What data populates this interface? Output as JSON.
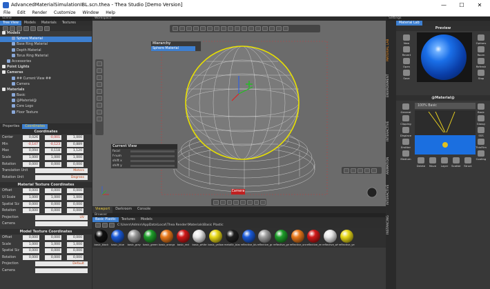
{
  "window": {
    "title": "AdvancedMaterialSimulationIBL.scn.thea - Thea Studio [Demo Version]",
    "minimize": "—",
    "maximize": "☐",
    "close": "✕"
  },
  "menu": [
    "File",
    "Edit",
    "Render",
    "Customize",
    "Window",
    "Help"
  ],
  "scene": {
    "header": "Scene",
    "tabs": [
      "Tree View",
      "Models",
      "Materials",
      "Textures"
    ],
    "tree": [
      {
        "label": "Models",
        "level": 0,
        "bold": true
      },
      {
        "label": "Sphere Material",
        "level": 2,
        "selected": true
      },
      {
        "label": "Base Ring Material",
        "level": 2
      },
      {
        "label": "Depth Material",
        "level": 2
      },
      {
        "label": "Torus Ring Material",
        "level": 2
      },
      {
        "label": "Accessories",
        "level": 1
      },
      {
        "label": "Point Lights",
        "level": 0,
        "bold": true
      },
      {
        "label": "Cameras",
        "level": 0,
        "bold": true
      },
      {
        "label": "## Current View ##",
        "level": 2
      },
      {
        "label": "Camera",
        "level": 2
      },
      {
        "label": "Materials",
        "level": 0,
        "bold": true
      },
      {
        "label": "Basic",
        "level": 2
      },
      {
        "label": "@Material@",
        "level": 2
      },
      {
        "label": "Core Logo",
        "level": 2
      },
      {
        "label": "Floor Texture",
        "level": 2
      }
    ]
  },
  "props": {
    "tabs": [
      "Properties",
      "Coordinates"
    ],
    "coord_title": "Coordinates",
    "coord_rows": [
      {
        "label": "Center",
        "v": [
          "0,026",
          "-0,001",
          "1,000"
        ],
        "red": [
          false,
          true,
          false
        ]
      },
      {
        "label": "Min",
        "v": [
          "-0,147",
          "-0,123",
          "0,889"
        ],
        "red": [
          true,
          true,
          false
        ]
      },
      {
        "label": "Max",
        "v": [
          "0,094",
          "0,118",
          "1,120"
        ],
        "red": [
          false,
          false,
          false
        ]
      },
      {
        "label": "Scale",
        "v": [
          "1,000",
          "1,000",
          "1,000"
        ],
        "red": [
          false,
          false,
          false
        ]
      },
      {
        "label": "Rotation",
        "v": [
          "0,000",
          "0,000",
          "0,000"
        ],
        "red": [
          false,
          false,
          false
        ]
      }
    ],
    "translation_unit": {
      "label": "Translation Unit",
      "value": "Meters"
    },
    "rotation_unit": {
      "label": "Rotation Unit",
      "value": "Degrees"
    },
    "mtc_title": "Material Texture Coordinates",
    "mtc_rows": [
      {
        "label": "Offset",
        "v": [
          "0,000",
          "0,000",
          "0,000"
        ]
      },
      {
        "label": "UI Scale",
        "v": [
          "1,000",
          "1,000",
          "1,000"
        ]
      },
      {
        "label": "Spatial Siz",
        "v": [
          "0,000",
          "0,000",
          "0,000"
        ]
      },
      {
        "label": "Rotation",
        "v": [
          "0,000",
          "0,000",
          "0,000"
        ]
      }
    ],
    "mtc_projection": {
      "label": "Projection",
      "value": "UV"
    },
    "mtc_camera": {
      "label": "Camera",
      "value": ""
    },
    "model_title": "Model Texture Coordinates",
    "model_rows": [
      {
        "label": "Offset",
        "v": [
          "0,000",
          "0,000",
          "0,000"
        ]
      },
      {
        "label": "Scale",
        "v": [
          "1,000",
          "1,000",
          "1,000"
        ]
      },
      {
        "label": "Spatial Siz",
        "v": [
          "0,000",
          "0,000",
          "0,000"
        ]
      },
      {
        "label": "Rotation",
        "v": [
          "0,000",
          "0,000",
          "0,000"
        ]
      }
    ],
    "model_projection": {
      "label": "Projection",
      "value": "Default"
    },
    "model_camera": {
      "label": "Camera",
      "value": ""
    }
  },
  "viewport": {
    "header": "Workspace",
    "hierarchy_title": "Hierarchy",
    "hierarchy_item": "Sphere Material",
    "current_view_title": "Current View",
    "current_view_rows": [
      "focal",
      "f-num",
      "shift x",
      "shift y"
    ],
    "camera_label": "Camera"
  },
  "viewtabs": [
    "Viewport",
    "Darkroom",
    "Console"
  ],
  "browser": {
    "header": "Browser",
    "tabs": [
      "Basic Plastic",
      "Textures",
      "Models"
    ],
    "path": "C:\\Users\\Admin\\AppData\\Local\\Thea Render\\Materials\\Basic Plastic",
    "swatches": [
      {
        "label": "basic_black",
        "color": "#111111"
      },
      {
        "label": "basic_blue",
        "color": "#1a5ad8"
      },
      {
        "label": "basic_gray",
        "color": "#9a9a9a"
      },
      {
        "label": "basic_green",
        "color": "#1e9e2a"
      },
      {
        "label": "basic_orange",
        "color": "#e8781a"
      },
      {
        "label": "basic_red",
        "color": "#d01818"
      },
      {
        "label": "basic_white",
        "color": "#e8e8e8"
      },
      {
        "label": "basic_yellow",
        "color": "#e8d818"
      },
      {
        "label": "metallic_black",
        "color": "#202020"
      },
      {
        "label": "reflective_blue",
        "color": "#1a5ad8"
      },
      {
        "label": "reflective_gray",
        "color": "#a0a0a0"
      },
      {
        "label": "reflective_green",
        "color": "#1e9e2a"
      },
      {
        "label": "reflective_orange",
        "color": "#e8781a"
      },
      {
        "label": "reflective_red",
        "color": "#d01818"
      },
      {
        "label": "reflective_white",
        "color": "#e8e8e8"
      },
      {
        "label": "reflective_yellow",
        "color": "#e8d818"
      }
    ]
  },
  "settings": {
    "header": "Settings",
    "tab": "Material Lab",
    "preview_title": "Preview",
    "side_tabs": [
      "MATERIAL LAB",
      "ENVIRONMENT",
      "INTERACTIVE",
      "ANIMATION",
      "INTERACTIVE",
      "INSTANCING"
    ],
    "left_buttons": [
      "New",
      "Revert",
      "Open",
      "Save"
    ],
    "right_buttons": [
      "Options",
      "Room",
      "Refresh",
      "Stop"
    ],
    "material_title": "@Material@",
    "layer_label": "100% Basic",
    "mat_left_buttons": [
      "General",
      "Clipping",
      "Displace",
      "Emitter",
      "Medium"
    ],
    "mat_right_buttons": [
      "Basic",
      "Glossy",
      "SSS",
      "ThinFilm",
      "Coating"
    ],
    "mat_bottom_buttons": [
      "Delete",
      "Move",
      "Layer",
      "Scatter",
      "Struct"
    ]
  },
  "colors": {
    "accent": "#3d7fd0",
    "selection_yellow": "#e8e000",
    "panel": "#3a3a3a"
  }
}
